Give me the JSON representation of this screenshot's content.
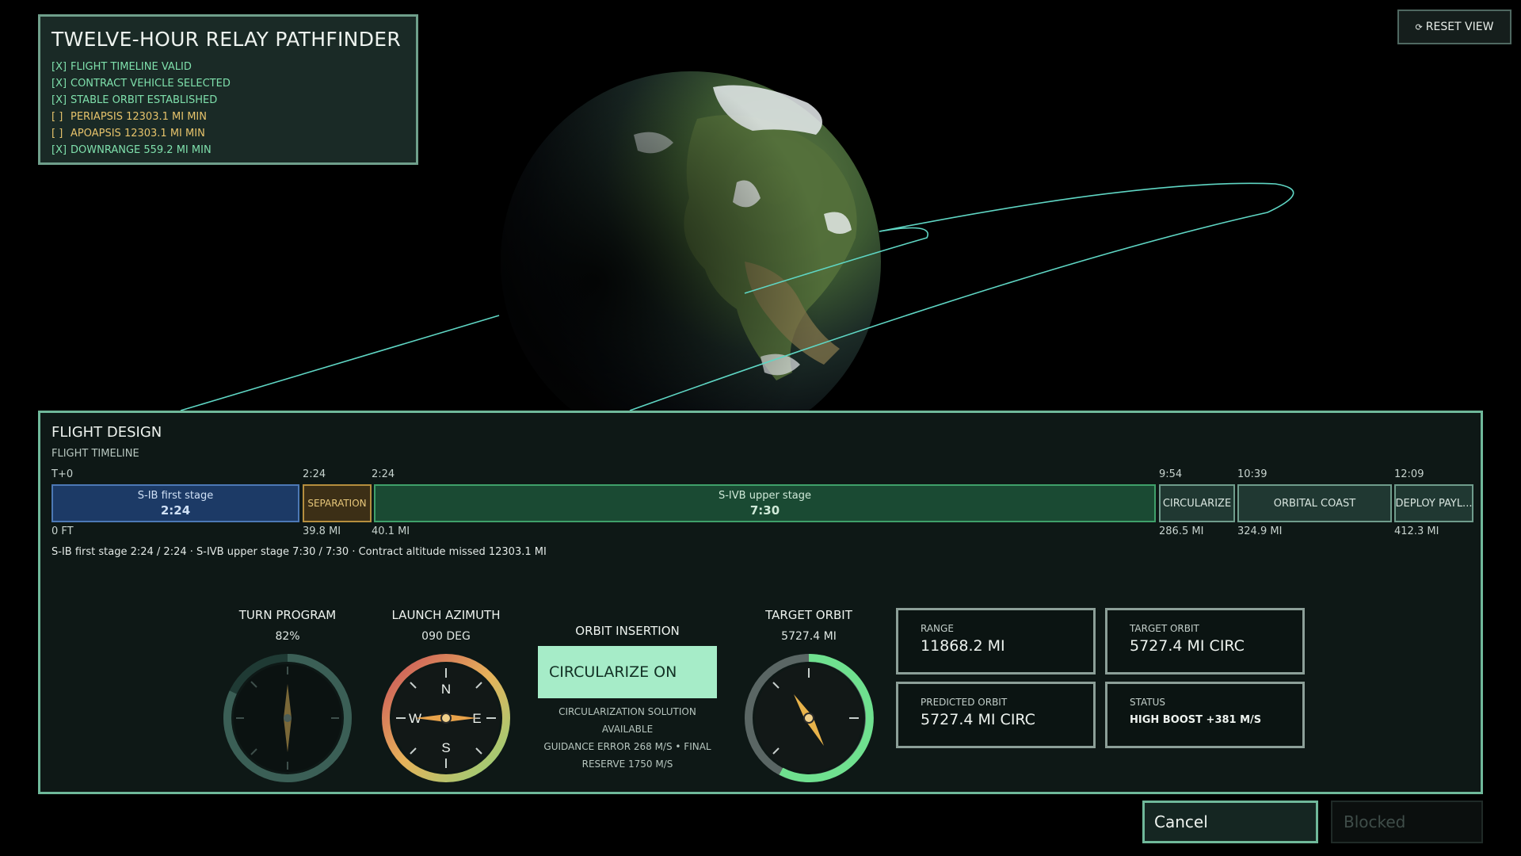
{
  "checklist": {
    "title": "TWELVE-HOUR RELAY PATHFINDER",
    "items": [
      {
        "mark": "[X]",
        "text": "FLIGHT TIMELINE VALID",
        "state": "done"
      },
      {
        "mark": "[X]",
        "text": "CONTRACT VEHICLE SELECTED",
        "state": "done"
      },
      {
        "mark": "[X]",
        "text": "STABLE ORBIT ESTABLISHED",
        "state": "done"
      },
      {
        "mark": "[ ]",
        "text": "PERIAPSIS  12303.1 MI MIN",
        "state": "todo"
      },
      {
        "mark": "[ ]",
        "text": "APOAPSIS  12303.1 MI MIN",
        "state": "todo"
      },
      {
        "mark": "[X]",
        "text": "DOWNRANGE  559.2 MI MIN",
        "state": "done"
      }
    ]
  },
  "reset_view": {
    "icon": "refresh-icon",
    "glyph": "⟳",
    "label": "RESET VIEW"
  },
  "design": {
    "title": "FLIGHT DESIGN",
    "timeline_label": "FLIGHT TIMELINE",
    "segments": [
      {
        "time": "T+0",
        "name": "S-IB first stage",
        "duration": "2:24",
        "alt": "0 FT"
      },
      {
        "time": "2:24",
        "name": "SEPARATION",
        "duration": "",
        "alt": "39.8 MI"
      },
      {
        "time": "2:24",
        "name": "S-IVB upper stage",
        "duration": "7:30",
        "alt": "40.1 MI"
      },
      {
        "time": "9:54",
        "name": "CIRCULARIZE",
        "duration": "",
        "alt": "286.5 MI"
      },
      {
        "time": "10:39",
        "name": "ORBITAL COAST",
        "duration": "",
        "alt": "324.9 MI"
      },
      {
        "time": "12:09",
        "name": "DEPLOY PAYL...",
        "duration": "",
        "alt": "412.3 MI"
      }
    ],
    "summary": "S-IB first stage  2:24 / 2:24  ·  S-IVB upper stage  7:30 / 7:30  ·  Contract altitude missed  12303.1 MI"
  },
  "gauges": {
    "turn_program": {
      "title": "TURN PROGRAM",
      "value": "82%",
      "fraction": 0.82
    },
    "launch_azimuth": {
      "title": "LAUNCH AZIMUTH",
      "value": "090 DEG",
      "heading_deg": 90,
      "n": "N",
      "e": "E",
      "s": "S",
      "w": "W"
    },
    "target_orbit": {
      "title": "TARGET ORBIT",
      "value": "5727.4 MI"
    }
  },
  "orbit_insertion": {
    "title": "ORBIT INSERTION",
    "button": "CIRCULARIZE ON",
    "note_1": "CIRCULARIZATION SOLUTION",
    "note_2": "AVAILABLE",
    "note_3": "GUIDANCE ERROR 268 M/S • FINAL",
    "note_4": "RESERVE 1750 M/S"
  },
  "info": {
    "range": {
      "label": "RANGE",
      "value": "11868.2 MI"
    },
    "target_orbit": {
      "label": "TARGET ORBIT",
      "value": "5727.4 MI CIRC"
    },
    "predicted_orbit": {
      "label": "PREDICTED ORBIT",
      "value": "5727.4 MI CIRC"
    },
    "status": {
      "label": "STATUS",
      "value": "HIGH BOOST  +381 M/S"
    }
  },
  "actions": {
    "cancel": "Cancel",
    "blocked": "Blocked"
  },
  "colors": {
    "accent": "#6fb89a",
    "orbit_line": "#5fd6c4",
    "done": "#7fe0ac",
    "todo": "#e6c36b",
    "circularize_bg": "#a6ecc8"
  }
}
